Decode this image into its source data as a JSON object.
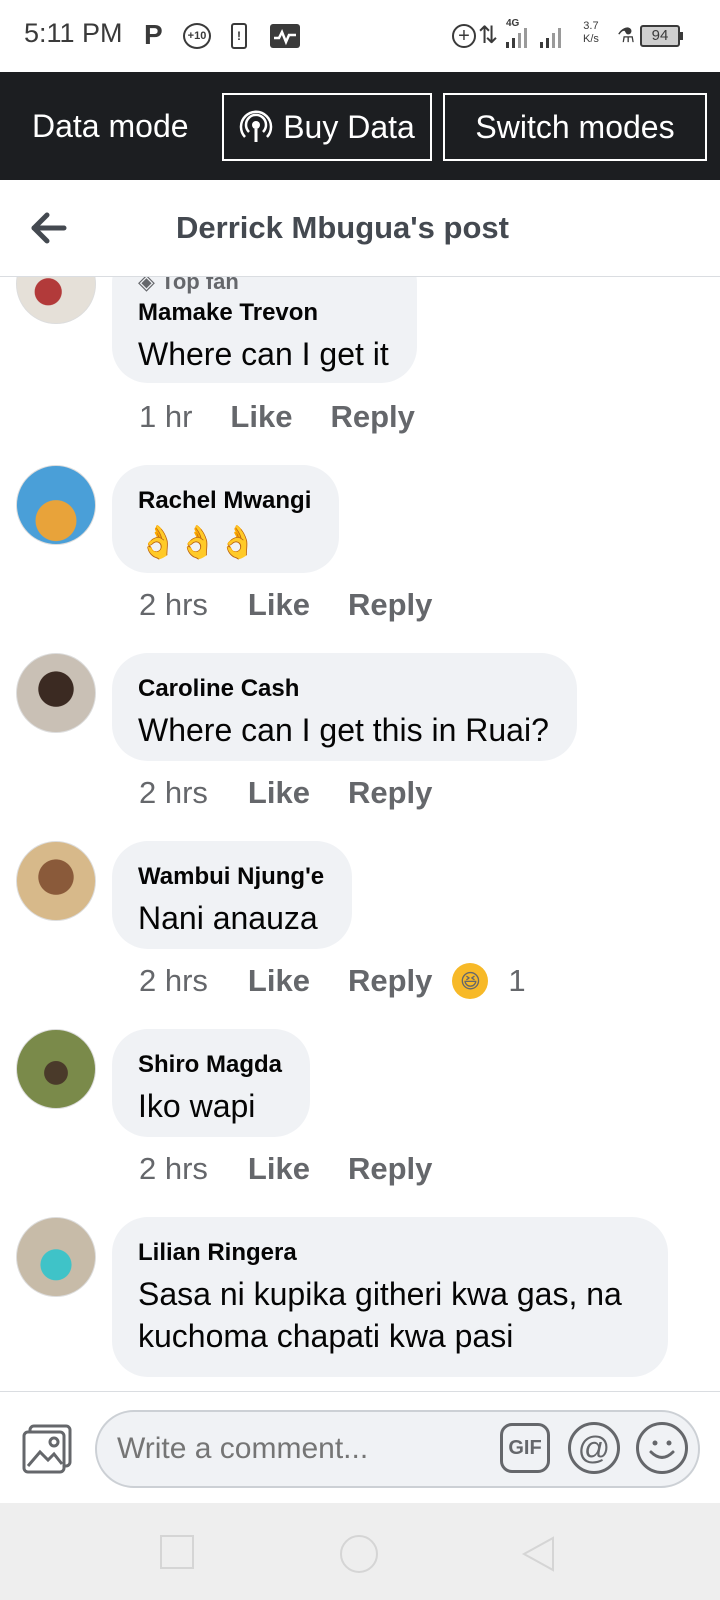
{
  "status_bar": {
    "time": "5:11 PM",
    "p_label": "P",
    "badge_label": "+10",
    "sim_label": "!",
    "network_type": "4G",
    "speed_value": "3.7",
    "speed_unit": "K/s",
    "battery": "94"
  },
  "data_bar": {
    "mode_label": "Data mode",
    "buy_label": "Buy Data",
    "switch_label": "Switch modes"
  },
  "header": {
    "title": "Derrick Mbugua's post"
  },
  "comments": [
    {
      "badge": "Top fan",
      "author": "Mamake Trevon",
      "text": "Where can I get it",
      "time": "1 hr",
      "like": "Like",
      "reply": "Reply"
    },
    {
      "author": "Rachel Mwangi",
      "text": "👌👌👌",
      "time": "2 hrs",
      "like": "Like",
      "reply": "Reply"
    },
    {
      "author": "Caroline Cash",
      "text": "Where can I get this in Ruai?",
      "time": "2 hrs",
      "like": "Like",
      "reply": "Reply"
    },
    {
      "author": "Wambui Njung'e",
      "text": "Nani anauza",
      "time": "2 hrs",
      "like": "Like",
      "reply": "Reply",
      "reaction_emoji": "😆",
      "reaction_count": "1"
    },
    {
      "author": "Shiro Magda",
      "text": "Iko wapi",
      "time": "2 hrs",
      "like": "Like",
      "reply": "Reply"
    },
    {
      "author": "Lilian Ringera",
      "text": "Sasa ni kupika githeri kwa gas, na kuchoma chapati kwa pasi"
    }
  ],
  "composer": {
    "placeholder": "Write a comment...",
    "gif_label": "GIF",
    "mention_label": "@"
  },
  "colors": {
    "data_bar_bg": "#1c1e21",
    "bubble_bg": "#f0f2f5",
    "secondary_text": "#65676b"
  }
}
